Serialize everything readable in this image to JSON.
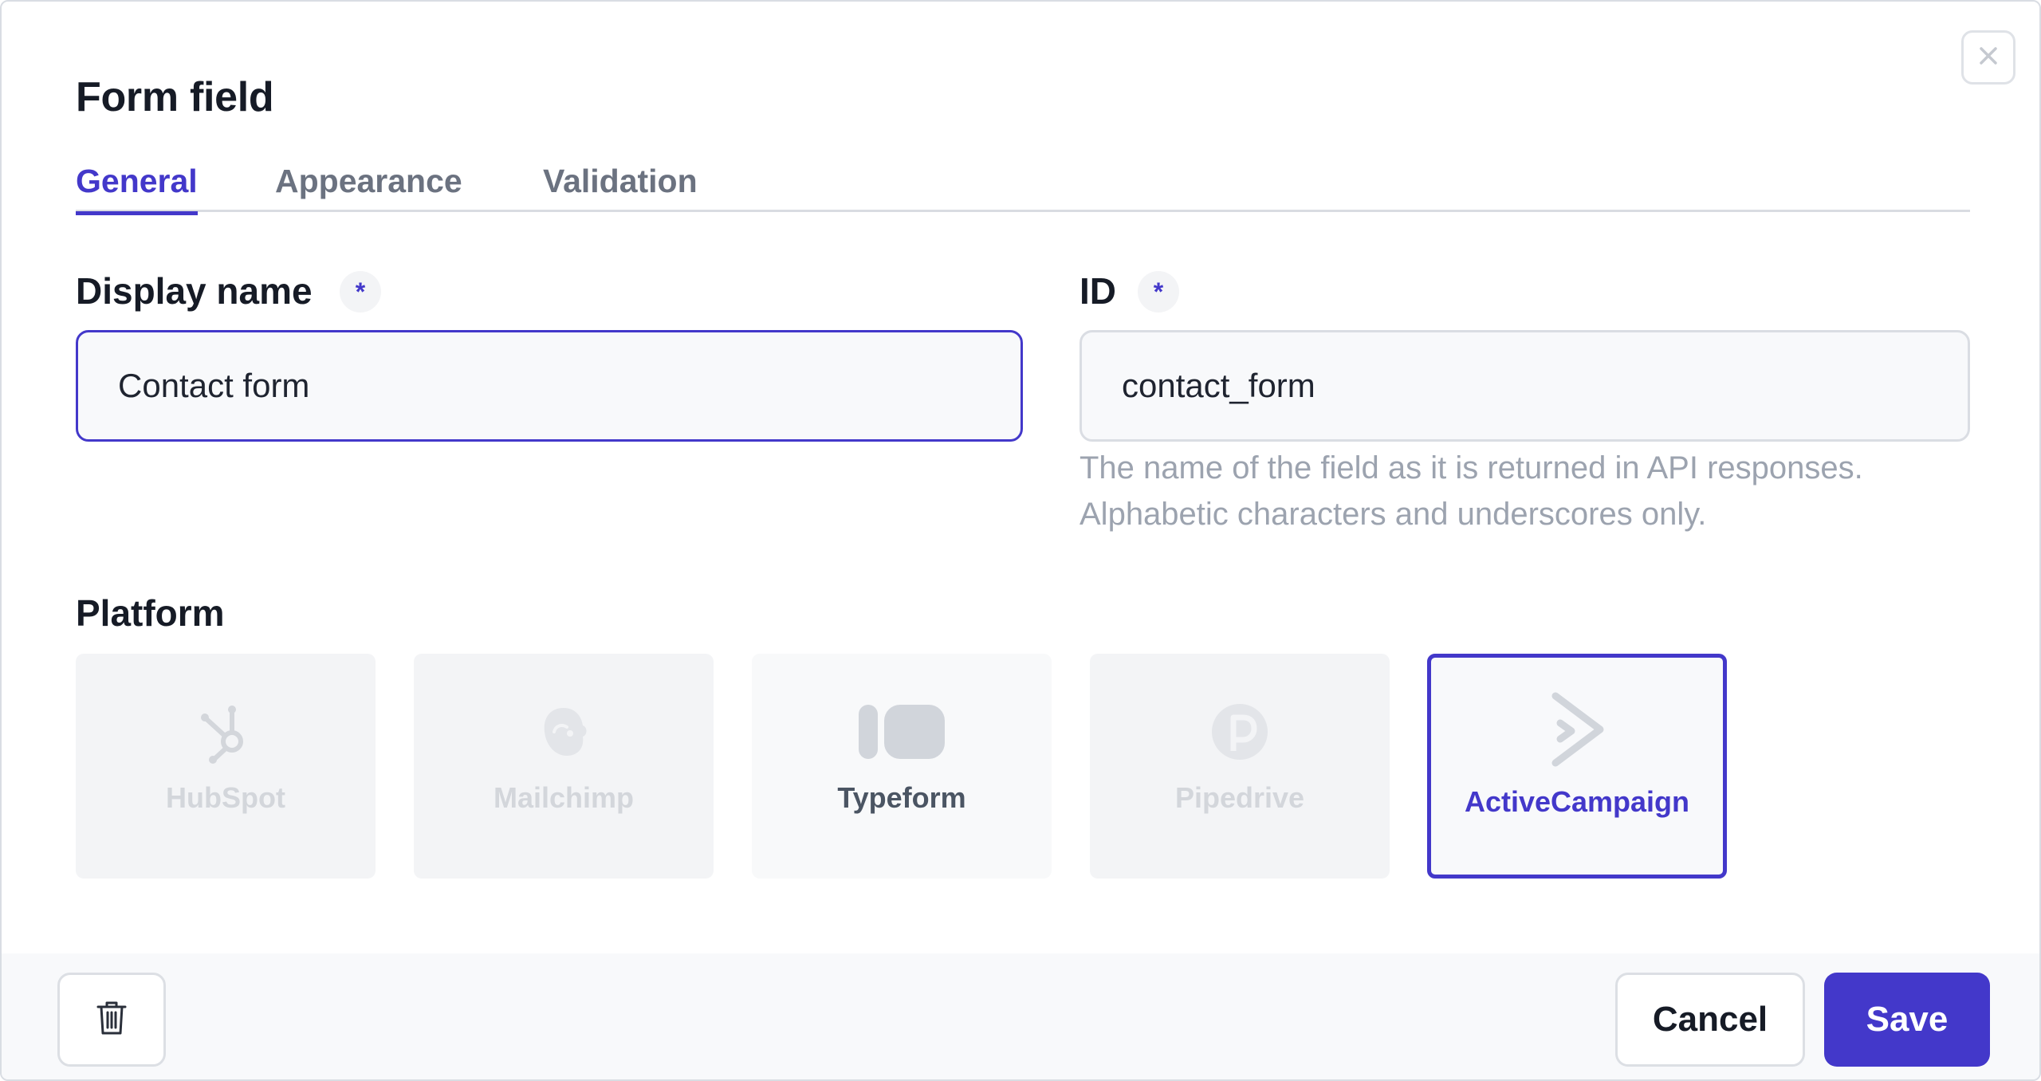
{
  "dialog": {
    "title": "Form field",
    "close_icon": "close-icon"
  },
  "tabs": [
    {
      "label": "General",
      "active": true
    },
    {
      "label": "Appearance",
      "active": false
    },
    {
      "label": "Validation",
      "active": false
    }
  ],
  "fields": {
    "display_name": {
      "label": "Display name",
      "required_marker": "*",
      "value": "Contact form"
    },
    "id": {
      "label": "ID",
      "required_marker": "*",
      "value": "contact_form",
      "hint_line1": "The name of the field as it is returned in API responses.",
      "hint_line2": "Alphabetic characters and underscores only."
    }
  },
  "platform": {
    "label": "Platform",
    "options": [
      {
        "name": "HubSpot",
        "icon": "hubspot-icon",
        "state": "disabled"
      },
      {
        "name": "Mailchimp",
        "icon": "mailchimp-icon",
        "state": "disabled"
      },
      {
        "name": "Typeform",
        "icon": "typeform-icon",
        "state": "enabled"
      },
      {
        "name": "Pipedrive",
        "icon": "pipedrive-icon",
        "state": "disabled"
      },
      {
        "name": "ActiveCampaign",
        "icon": "activecampaign-icon",
        "state": "selected"
      }
    ]
  },
  "footer": {
    "delete_icon": "trash-icon",
    "cancel_label": "Cancel",
    "save_label": "Save"
  },
  "colors": {
    "accent": "#4338ca",
    "muted_text": "#6b7280",
    "hint_text": "#9ca3af",
    "disabled_card": "#f3f4f6"
  }
}
